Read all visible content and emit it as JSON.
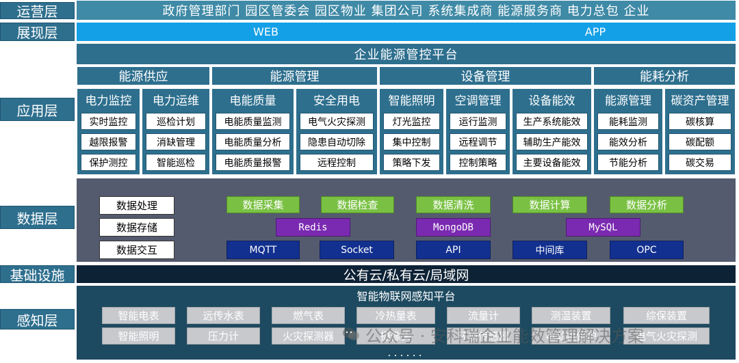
{
  "layers": {
    "ops": "运营层",
    "display": "展现层",
    "app": "应用层",
    "data": "数据层",
    "infra": "基础设施",
    "sense": "感知层"
  },
  "ops_bar": "政府管理部门  园区管委会  园区物业  集团公司  系统集成商  能源服务商  电力总包  企业",
  "display_bar": {
    "web": "WEB",
    "app": "APP"
  },
  "platform_title": "企业能源管控平台",
  "categories": [
    "能源供应",
    "能源管理",
    "设备管理",
    "能耗分析"
  ],
  "app_modules": [
    {
      "title": "电力监控",
      "items": [
        "实时监控",
        "越限报警",
        "保护测控"
      ]
    },
    {
      "title": "电力运维",
      "items": [
        "巡检计划",
        "消缺管理",
        "智能巡检"
      ]
    },
    {
      "title": "电能质量",
      "items": [
        "电能质量监测",
        "电能质量分析",
        "电能质量报警"
      ]
    },
    {
      "title": "安全用电",
      "items": [
        "电气火灾探测",
        "隐患自动切除",
        "远程控制"
      ]
    },
    {
      "title": "智能照明",
      "items": [
        "灯光监控",
        "集中控制",
        "策略下发"
      ]
    },
    {
      "title": "空调管理",
      "items": [
        "运行监测",
        "远程调节",
        "控制策略"
      ]
    },
    {
      "title": "设备能效",
      "items": [
        "生产系统能效",
        "辅助生产能效",
        "主要设备能效"
      ]
    },
    {
      "title": "能源管理",
      "items": [
        "能耗监测",
        "能效分析",
        "节能分析"
      ]
    },
    {
      "title": "碳资产管理",
      "items": [
        "碳核算",
        "碳配额",
        "碳交易"
      ]
    }
  ],
  "data_layer": {
    "white": [
      "数据处理",
      "数据存储",
      "数据交互"
    ],
    "green": [
      "数据采集",
      "数据检查",
      "数据清洗",
      "数据计算",
      "数据分析"
    ],
    "purple": [
      "Redis",
      "MongoDB",
      "MySQL"
    ],
    "navy": [
      "MQTT",
      "Socket",
      "API",
      "中间库",
      "OPC"
    ]
  },
  "infra_bar": "公有云/私有云/局域网",
  "sense_layer": {
    "title": "智能物联网感知平台",
    "row1": [
      "智能电表",
      "远传水表",
      "燃气表",
      "冷热量表",
      "流量计",
      "测温装置",
      "综保装置"
    ],
    "row2": [
      "智能照明",
      "压力计",
      "火灾探测器",
      "摄像头",
      "环境传感器",
      "电动机保护",
      "电气火灾探测"
    ],
    "more": "......"
  },
  "watermark": "公众号 · 安科瑞企业能效管理解决方案",
  "colors": {
    "label": "#2e6f8e",
    "display": "#14a0e6",
    "green": "#7ac143",
    "purple": "#7a2ab0",
    "navy": "#12308f",
    "data_panel": "#555b6e",
    "infra": "#0e2236"
  }
}
